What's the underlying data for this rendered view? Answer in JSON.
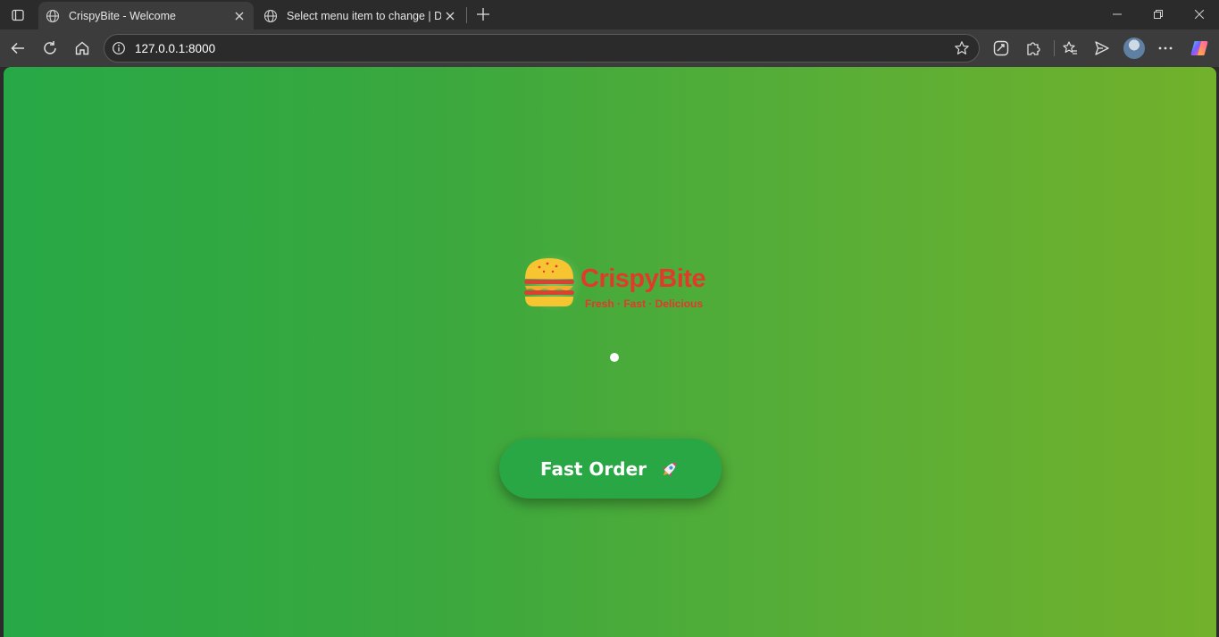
{
  "browser": {
    "tabs": [
      {
        "title": "CrispyBite - Welcome",
        "active": true
      },
      {
        "title": "Select menu item to change | Dja",
        "active": false
      }
    ],
    "address_bar": {
      "url": "127.0.0.1:8000"
    }
  },
  "page": {
    "brand": {
      "name": "CrispyBite",
      "tagline": "Fresh · Fast · Delicious"
    },
    "cta_label": "Fast Order",
    "colors": {
      "background_start": "#27a846",
      "background_end": "#72b12b",
      "button": "#29a745",
      "brand_red": "#e23a2a",
      "bun": "#f7c531"
    }
  }
}
